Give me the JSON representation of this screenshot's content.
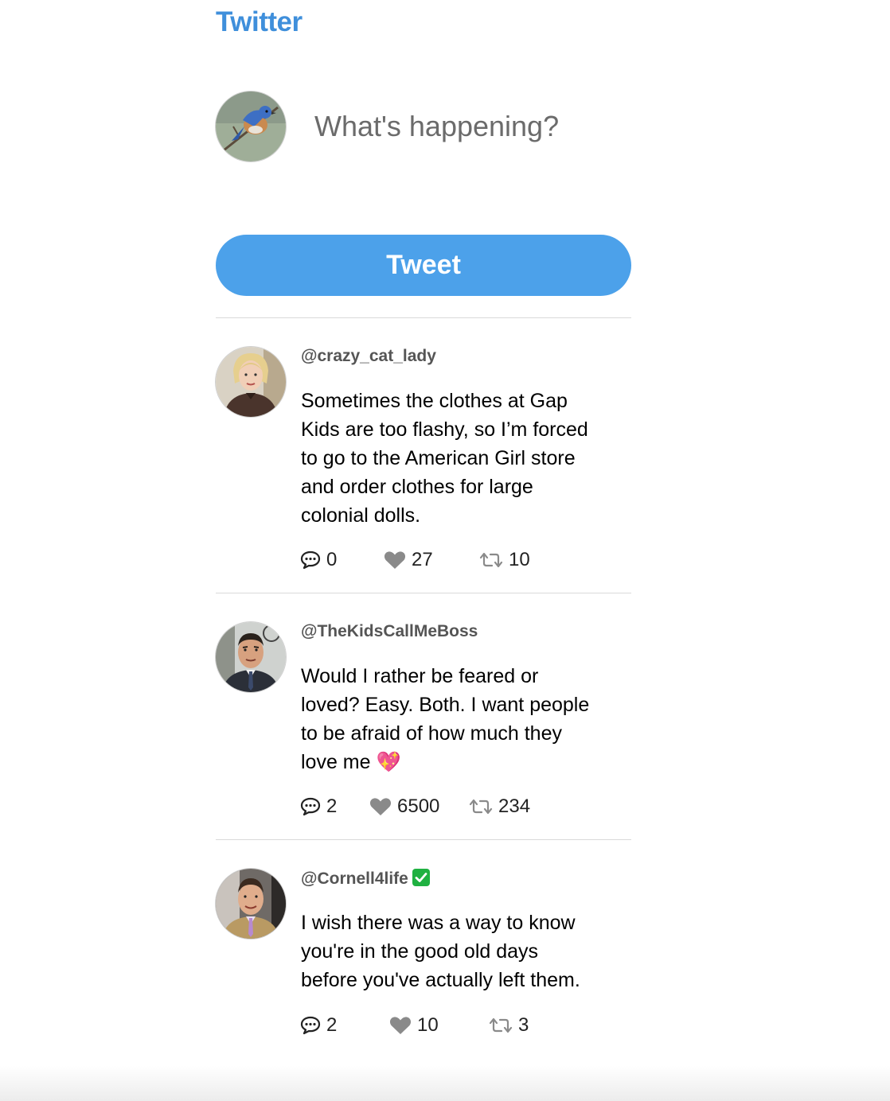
{
  "header": {
    "title": "Twitter"
  },
  "compose": {
    "placeholder": "What's happening?",
    "avatar_icon": "bluebird-avatar-icon",
    "button_label": "Tweet"
  },
  "colors": {
    "brand": "#3f8fdb",
    "button": "#4ca1ea",
    "divider": "#d9d9d9",
    "handle": "#555555",
    "icon": "#8a8a8a",
    "verified": "#1fb141"
  },
  "tweets": [
    {
      "handle": "@crazy_cat_lady",
      "verified": false,
      "text": "Sometimes the clothes at Gap Kids are too flashy, so I’m forced to go to the American Girl store and order clothes for large colonial dolls.",
      "replies": "0",
      "likes": "27",
      "retweets": "10"
    },
    {
      "handle": "@TheKidsCallMeBoss",
      "verified": false,
      "text": "Would I rather be feared or loved? Easy. Both. I want people to be afraid of how much they love me 💖",
      "replies": "2",
      "likes": "6500",
      "retweets": "234"
    },
    {
      "handle": "@Cornell4life",
      "verified": true,
      "text": "I wish there was a way to know you're in the good old days before you've actually left them.",
      "replies": "2",
      "likes": "10",
      "retweets": "3"
    }
  ]
}
